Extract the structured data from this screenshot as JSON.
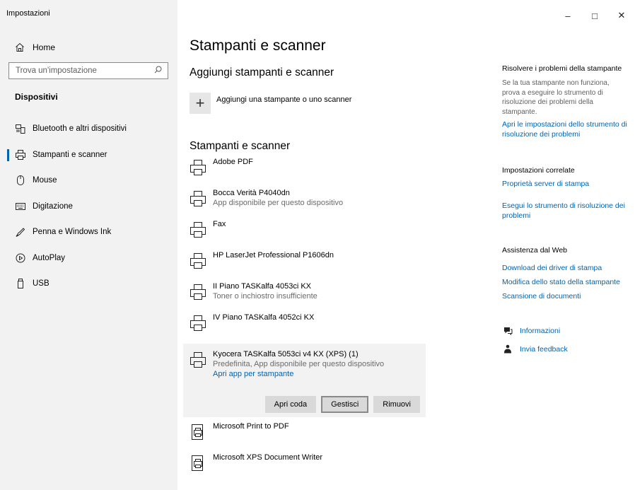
{
  "window": {
    "title": "Impostazioni",
    "controls": {
      "minimize": "–",
      "maximize": "□",
      "close": "✕"
    }
  },
  "sidebar": {
    "home_label": "Home",
    "search_placeholder": "Trova un'impostazione",
    "section_title": "Dispositivi",
    "items": [
      {
        "label": "Bluetooth e altri dispositivi",
        "icon": "bluetooth-devices-icon"
      },
      {
        "label": "Stampanti e scanner",
        "icon": "printer-icon",
        "selected": true
      },
      {
        "label": "Mouse",
        "icon": "mouse-icon"
      },
      {
        "label": "Digitazione",
        "icon": "keyboard-icon"
      },
      {
        "label": "Penna e Windows Ink",
        "icon": "pen-icon"
      },
      {
        "label": "AutoPlay",
        "icon": "autoplay-icon"
      },
      {
        "label": "USB",
        "icon": "usb-icon"
      }
    ]
  },
  "main": {
    "page_title": "Stampanti e scanner",
    "add_heading": "Aggiungi stampanti e scanner",
    "add_label": "Aggiungi una stampante o uno scanner",
    "list_heading": "Stampanti e scanner",
    "printers": [
      {
        "name": "Adobe PDF",
        "sub": ""
      },
      {
        "name": "Bocca Verità P4040dn",
        "sub": "App disponibile per questo dispositivo"
      },
      {
        "name": "Fax",
        "sub": ""
      },
      {
        "name": "HP LaserJet Professional P1606dn",
        "sub": ""
      },
      {
        "name": "II Piano TASKalfa 4053ci KX",
        "sub": "Toner o inchiostro insufficiente"
      },
      {
        "name": "IV Piano TASKalfa 4052ci KX",
        "sub": ""
      },
      {
        "name": "Kyocera TASKalfa 5053ci v4 KX (XPS) (1)",
        "sub": "Predefinita, App disponibile per questo dispositivo",
        "link": "Apri app per stampante"
      },
      {
        "name": "Microsoft Print to PDF",
        "sub": ""
      },
      {
        "name": "Microsoft XPS Document Writer",
        "sub": ""
      }
    ],
    "actions": {
      "open_queue": "Apri coda",
      "manage": "Gestisci",
      "remove": "Rimuovi"
    }
  },
  "right_panel": {
    "troubleshoot_heading": "Risolvere i problemi della stampante",
    "troubleshoot_text": "Se la tua stampante non funziona, prova a eseguire lo strumento di risoluzione dei problemi della stampante.",
    "troubleshoot_link": "Apri le impostazioni dello strumento di risoluzione dei problemi",
    "related_heading": "Impostazioni correlate",
    "print_server_link": "Proprietà server di stampa",
    "run_troubleshooter_link": "Esegui lo strumento di risoluzione dei problemi",
    "web_heading": "Assistenza dal Web",
    "download_drivers_link": "Download dei driver di stampa",
    "change_status_link": "Modifica dello stato della stampante",
    "scan_docs_link": "Scansione di documenti",
    "info_label": "Informazioni",
    "feedback_label": "Invia feedback"
  }
}
